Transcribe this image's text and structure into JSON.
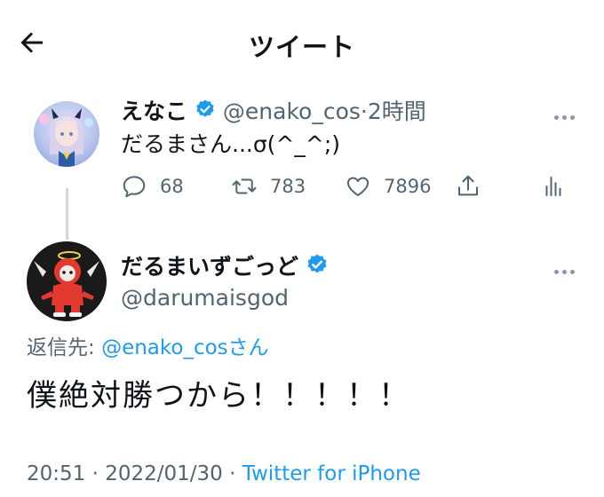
{
  "header": {
    "title": "ツイート"
  },
  "parent_tweet": {
    "display_name": "えなこ",
    "handle": "@enako_cos",
    "separator": "·",
    "time_ago": "2時間",
    "text": "だるまさん...σ(^_^;)",
    "reply_count": "68",
    "retweet_count": "783",
    "like_count": "7896"
  },
  "reply_tweet": {
    "display_name": "だるまいずごっど",
    "handle": "@darumaisgod",
    "reply_prefix": "返信先: ",
    "reply_target": "@enako_cos",
    "reply_suffix": "さん",
    "text": "僕絶対勝つから！！！！！",
    "time": "20:51",
    "date": "2022/01/30",
    "separator": "·",
    "source": "Twitter for iPhone"
  },
  "colors": {
    "accent": "#1d9bf0",
    "muted": "#536471",
    "text": "#0f1419"
  }
}
